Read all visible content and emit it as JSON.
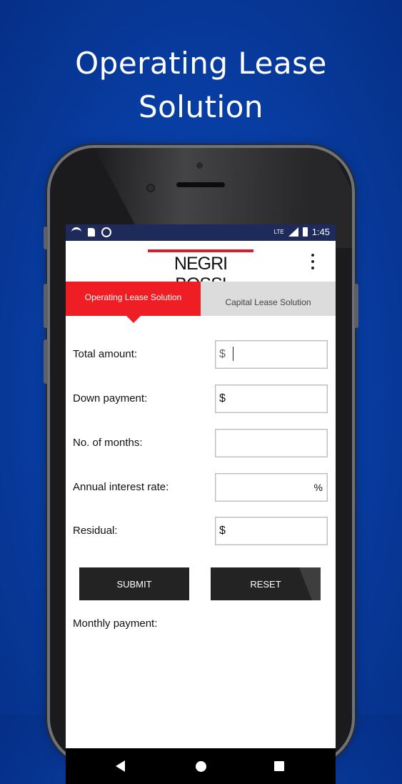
{
  "promo": {
    "line1": "Operating Lease",
    "line2": "Solution"
  },
  "status_bar": {
    "time": "1:45",
    "network": "LTE"
  },
  "app": {
    "logo": "NEGRI BOSSI"
  },
  "tabs": [
    {
      "label": "Operating Lease Solution",
      "active": true
    },
    {
      "label": "Capital Lease Solution",
      "active": false
    }
  ],
  "form": {
    "total_amount": {
      "label": "Total amount:",
      "prefix": "$",
      "value": ""
    },
    "down_payment": {
      "label": "Down payment:",
      "prefix": "$",
      "value": ""
    },
    "months": {
      "label": "No. of months:",
      "value": ""
    },
    "interest": {
      "label": "Annual interest rate:",
      "suffix": "%",
      "value": ""
    },
    "residual": {
      "label": "Residual:",
      "prefix": "$",
      "value": ""
    }
  },
  "buttons": {
    "submit": "SUBMIT",
    "reset": "RESET"
  },
  "result": {
    "label": "Monthly payment:"
  },
  "colors": {
    "background": "#083fa6",
    "accent": "#ef1d24",
    "button": "#232323"
  }
}
